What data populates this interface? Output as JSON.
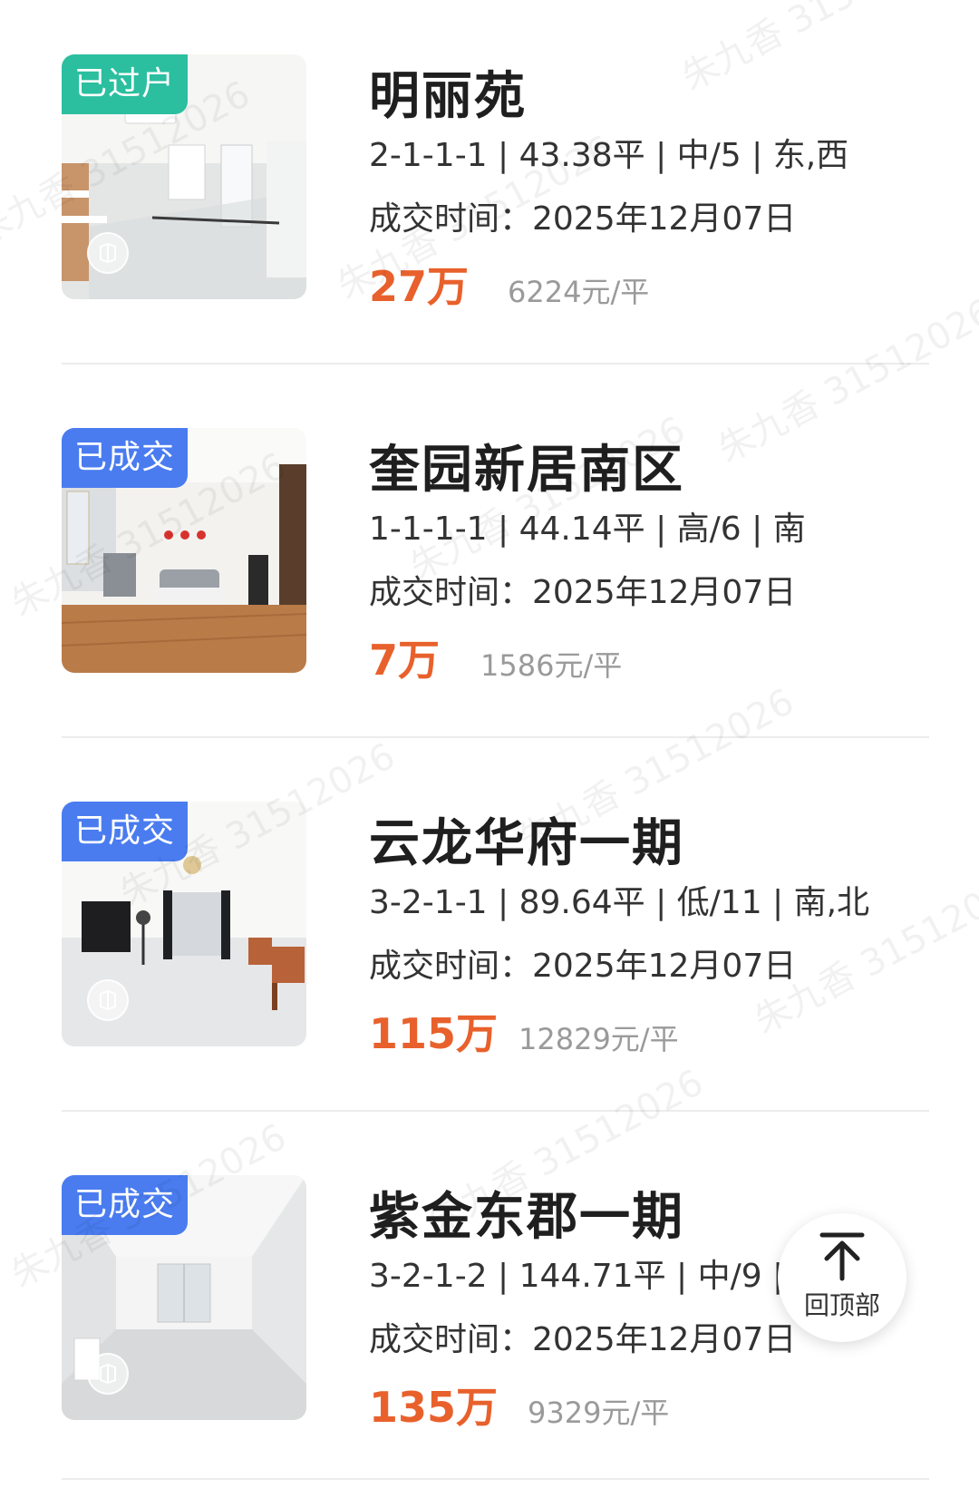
{
  "listings": [
    {
      "status": "已过户",
      "status_color": "#2bbfa0",
      "name": "明丽苑",
      "meta": "2-1-1-1 | 43.38平 | 中/5 | 东,西",
      "deal_date": "成交时间：2025年12月07日",
      "price": "27万",
      "unit_price": "6224元/平"
    },
    {
      "status": "已成交",
      "status_color": "#4a7cf0",
      "name": "奎园新居南区",
      "meta": "1-1-1-1 | 44.14平 | 高/6 | 南",
      "deal_date": "成交时间：2025年12月07日",
      "price": "7万",
      "unit_price": "1586元/平"
    },
    {
      "status": "已成交",
      "status_color": "#4a7cf0",
      "name": "云龙华府一期",
      "meta": "3-2-1-1 | 89.64平 | 低/11 | 南,北",
      "deal_date": "成交时间：2025年12月07日",
      "price": "115万",
      "unit_price": "12829元/平"
    },
    {
      "status": "已成交",
      "status_color": "#4a7cf0",
      "name": "紫金东郡一期",
      "meta": "3-2-1-2 | 144.71平 | 中/9 |",
      "deal_date": "成交时间：2025年12月07日",
      "price": "135万",
      "unit_price": "9329元/平"
    }
  ],
  "back_to_top": {
    "label": "回顶部",
    "icon": "arrow-up-icon"
  },
  "watermark": {
    "text": "朱九香 31512026"
  },
  "colors": {
    "price": "#e8612c",
    "status_transferred": "#2bbfa0",
    "status_closed": "#4a7cf0"
  }
}
